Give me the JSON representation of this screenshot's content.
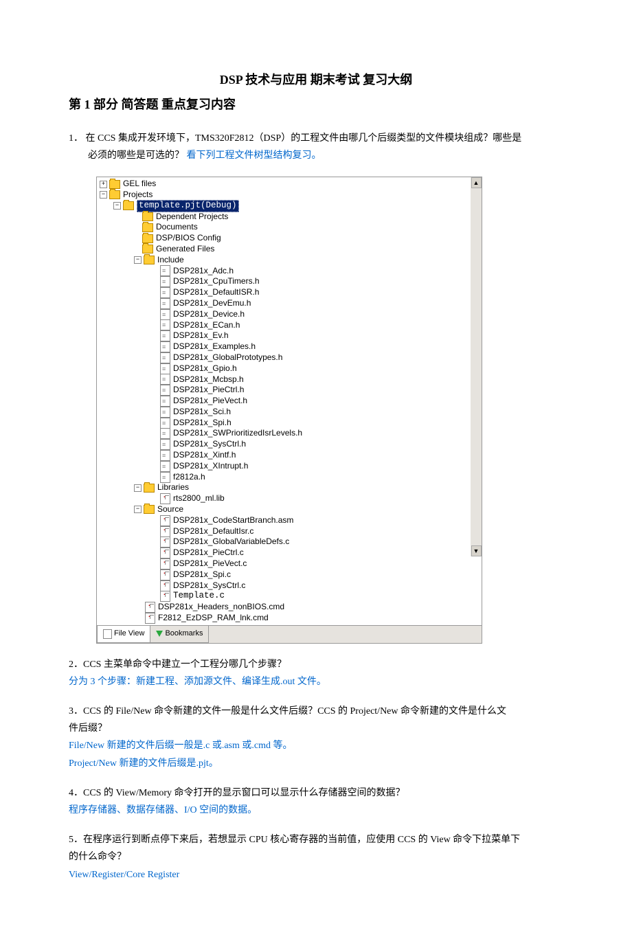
{
  "title": "DSP 技术与应用  期末考试 复习大纲",
  "section1_heading": "第 1 部分   简答题  重点复习内容",
  "q1": {
    "num": "1．",
    "text_a": "在 CCS 集成开发环境下，TMS320F2812（DSP）的工程文件由哪几个后缀类型的文件模块组成？哪些是",
    "text_b": "必须的哪些是可选的？",
    "link": "看下列工程文件树型结构复习。"
  },
  "tree": {
    "gel": "GEL files",
    "projects": "Projects",
    "pjt": "template.pjt(Debug)",
    "folders": [
      "Dependent Projects",
      "Documents",
      "DSP/BIOS Config",
      "Generated Files"
    ],
    "include": "Include",
    "headers": [
      "DSP281x_Adc.h",
      "DSP281x_CpuTimers.h",
      "DSP281x_DefaultISR.h",
      "DSP281x_DevEmu.h",
      "DSP281x_Device.h",
      "DSP281x_ECan.h",
      "DSP281x_Ev.h",
      "DSP281x_Examples.h",
      "DSP281x_GlobalPrototypes.h",
      "DSP281x_Gpio.h",
      "DSP281x_Mcbsp.h",
      "DSP281x_PieCtrl.h",
      "DSP281x_PieVect.h",
      "DSP281x_Sci.h",
      "DSP281x_Spi.h",
      "DSP281x_SWPrioritizedIsrLevels.h",
      "DSP281x_SysCtrl.h",
      "DSP281x_Xintf.h",
      "DSP281x_XIntrupt.h",
      "f2812a.h"
    ],
    "libraries": "Libraries",
    "libfile": "rts2800_ml.lib",
    "source": "Source",
    "sources": [
      "DSP281x_CodeStartBranch.asm",
      "DSP281x_DefaultIsr.c",
      "DSP281x_GlobalVariableDefs.c",
      "DSP281x_PieCtrl.c",
      "DSP281x_PieVect.c",
      "DSP281x_Spi.c",
      "DSP281x_SysCtrl.c",
      "Template.c"
    ],
    "cmds": [
      "DSP281x_Headers_nonBIOS.cmd",
      "F2812_EzDSP_RAM_lnk.cmd"
    ],
    "tab_file": "File View",
    "tab_book": "Bookmarks"
  },
  "q2": {
    "text": "2．CCS 主菜单命令中建立一个工程分哪几个步骤？",
    "ans": "分为 3 个步骤：新建工程、添加源文件、编译生成.out 文件。"
  },
  "q3": {
    "text_a": "3．CCS 的 File/New 命令新建的文件一般是什么文件后缀？CCS 的 Project/New 命令新建的文件是什么文",
    "text_b": "件后缀？",
    "ans_a": "File/New 新建的文件后缀一般是.c 或.asm 或.cmd 等。",
    "ans_b": "Project/New 新建的文件后缀是.pjt。"
  },
  "q4": {
    "text": "4．CCS 的 View/Memory 命令打开的显示窗口可以显示什么存储器空间的数据？",
    "ans": "程序存储器、数据存储器、I/O 空间的数据。"
  },
  "q5": {
    "text_a": "5．在程序运行到断点停下来后，若想显示 CPU 核心寄存器的当前值，应使用 CCS 的 View 命令下拉菜单下",
    "text_b": "的什么命令？",
    "ans": "View/Register/Core Register"
  }
}
